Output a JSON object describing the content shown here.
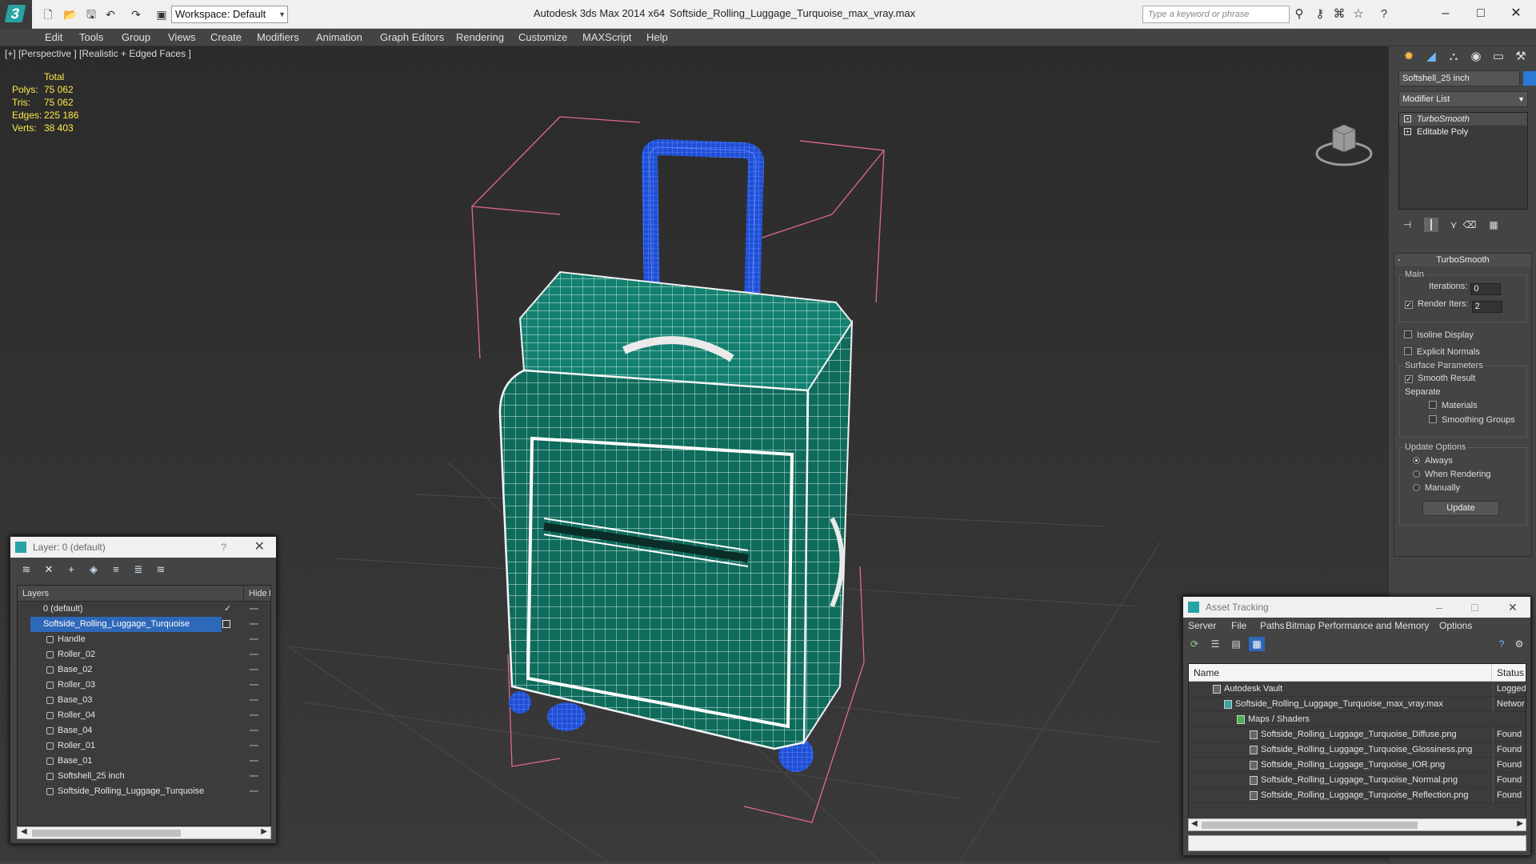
{
  "titlebar": {
    "workspace": "Workspace: Default",
    "app_title": "Autodesk 3ds Max  2014 x64",
    "file_title": "Softside_Rolling_Luggage_Turquoise_max_vray.max",
    "search_placeholder": "Type a keyword or phrase"
  },
  "menu": [
    "Edit",
    "Tools",
    "Group",
    "Views",
    "Create",
    "Modifiers",
    "Animation",
    "Graph Editors",
    "Rendering",
    "Customize",
    "MAXScript",
    "Help"
  ],
  "viewport": {
    "label": "[+] [Perspective ] [Realistic + Edged Faces ]",
    "stats": {
      "header": "Total",
      "rows": [
        {
          "k": "Polys:",
          "v": "75 062"
        },
        {
          "k": "Tris:",
          "v": "75 062"
        },
        {
          "k": "Edges:",
          "v": "225 186"
        },
        {
          "k": "Verts:",
          "v": "38 403"
        }
      ]
    }
  },
  "command_panel": {
    "object_name": "Softshell_25 inch",
    "object_color": "#2a7ad6",
    "modifier_list": "Modifier List",
    "stack": [
      "TurboSmooth",
      "Editable Poly"
    ],
    "rollout_title": "TurboSmooth",
    "main_label": "Main",
    "iterations_label": "Iterations:",
    "iterations_value": "0",
    "render_iters_label": "Render Iters:",
    "render_iters_value": "2",
    "isoline": "Isoline Display",
    "explicit_normals": "Explicit Normals",
    "surface_params": "Surface Parameters",
    "smooth_result": "Smooth Result",
    "separate": "Separate",
    "materials": "Materials",
    "smoothing_groups": "Smoothing Groups",
    "update_options": "Update Options",
    "always": "Always",
    "when_rendering": "When Rendering",
    "manually": "Manually",
    "update_button": "Update"
  },
  "layer_window": {
    "title": "Layer: 0 (default)",
    "help": "?",
    "col_layers": "Layers",
    "col_hide": "Hide",
    "col_f": "F",
    "rows": [
      {
        "name": "0 (default)",
        "indent": 0
      },
      {
        "name": "Softside_Rolling_Luggage_Turquoise",
        "indent": 0
      },
      {
        "name": "Handle",
        "indent": 1
      },
      {
        "name": "Roller_02",
        "indent": 1
      },
      {
        "name": "Base_02",
        "indent": 1
      },
      {
        "name": "Roller_03",
        "indent": 1
      },
      {
        "name": "Base_03",
        "indent": 1
      },
      {
        "name": "Roller_04",
        "indent": 1
      },
      {
        "name": "Base_04",
        "indent": 1
      },
      {
        "name": "Roller_01",
        "indent": 1
      },
      {
        "name": "Base_01",
        "indent": 1
      },
      {
        "name": "Softshell_25 inch",
        "indent": 1
      },
      {
        "name": "Softside_Rolling_Luggage_Turquoise",
        "indent": 1
      }
    ]
  },
  "asset_window": {
    "title": "Asset Tracking",
    "menu": [
      "Server",
      "File",
      "Paths",
      "Bitmap Performance and Memory",
      "Options"
    ],
    "col_name": "Name",
    "col_status": "Status",
    "rows": [
      {
        "name": "Autodesk Vault",
        "status": "Logged",
        "indent": 1
      },
      {
        "name": "Softside_Rolling_Luggage_Turquoise_max_vray.max",
        "status": "Networ",
        "indent": 2
      },
      {
        "name": "Maps / Shaders",
        "status": "",
        "indent": 3
      },
      {
        "name": "Softside_Rolling_Luggage_Turquoise_Diffuse.png",
        "status": "Found",
        "indent": 4
      },
      {
        "name": "Softside_Rolling_Luggage_Turquoise_Glossiness.png",
        "status": "Found",
        "indent": 4
      },
      {
        "name": "Softside_Rolling_Luggage_Turquoise_IOR.png",
        "status": "Found",
        "indent": 4
      },
      {
        "name": "Softside_Rolling_Luggage_Turquoise_Normal.png",
        "status": "Found",
        "indent": 4
      },
      {
        "name": "Softside_Rolling_Luggage_Turquoise_Reflection.png",
        "status": "Found",
        "indent": 4
      }
    ]
  },
  "colors": {
    "luggage": "#0f6b5c",
    "handle": "#1f4fd6",
    "selection": "#2e68b8",
    "stats": "#ffe84a"
  }
}
